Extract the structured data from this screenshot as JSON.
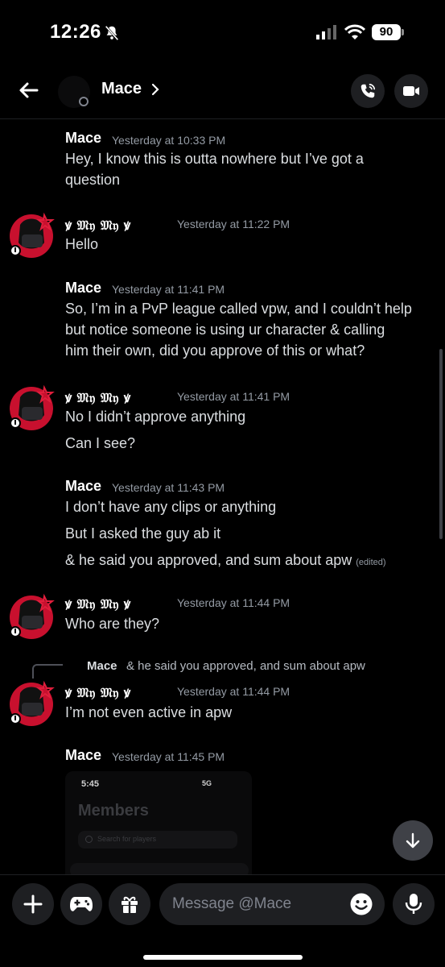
{
  "status_bar": {
    "time": "12:26",
    "battery": "90"
  },
  "header": {
    "name": "Mace"
  },
  "messages": [
    {
      "author": "Mace",
      "timestamp": "Yesterday at 10:33 PM",
      "lines": [
        "Hey, I know this is outta nowhere but I’ve got a",
        "question"
      ]
    },
    {
      "author": "ꝟ 𝔐𝔶 𝔐𝔶 ꝟ",
      "timestamp": "Yesterday at 11:22 PM",
      "lines": [
        "Hello"
      ]
    },
    {
      "author": "Mace",
      "timestamp": "Yesterday at 11:41 PM",
      "lines": [
        "So, I’m in a PvP league called vpw, and I couldn’t help",
        "but notice someone is using ur character & calling",
        "him their own, did you approve of this or what?"
      ]
    },
    {
      "author": "ꝟ 𝔐𝔶 𝔐𝔶 ꝟ",
      "timestamp": "Yesterday at 11:41 PM",
      "lines": [
        "No I didn’t approve anything",
        "Can I see?"
      ]
    },
    {
      "author": "Mace",
      "timestamp": "Yesterday at 11:43 PM",
      "lines": [
        "I don’t have any clips or anything",
        "But I asked the guy ab it",
        "& he said you approved, and sum about apw"
      ],
      "edited": "(edited)"
    },
    {
      "author": "ꝟ 𝔐𝔶 𝔐𝔶 ꝟ",
      "timestamp": "Yesterday at 11:44 PM",
      "lines": [
        "Who are they?"
      ]
    },
    {
      "reply_to": {
        "author": "Mace",
        "text": "& he said you approved, and sum about apw"
      },
      "author": "ꝟ 𝔐𝔶 𝔐𝔶 ꝟ",
      "timestamp": "Yesterday at 11:44 PM",
      "lines": [
        "I’m not even active in apw"
      ]
    },
    {
      "author": "Mace",
      "timestamp": "Yesterday at 11:45 PM",
      "attachment": {
        "time": "5:45",
        "status": "5G",
        "title": "Members",
        "search_placeholder": "Search for players"
      }
    }
  ],
  "composer": {
    "placeholder": "Message @Mace"
  },
  "colors": {
    "background": "#000000",
    "surface": "#1e1f22",
    "muted_text": "#949ba4",
    "avatar_red": "#c8102e"
  }
}
